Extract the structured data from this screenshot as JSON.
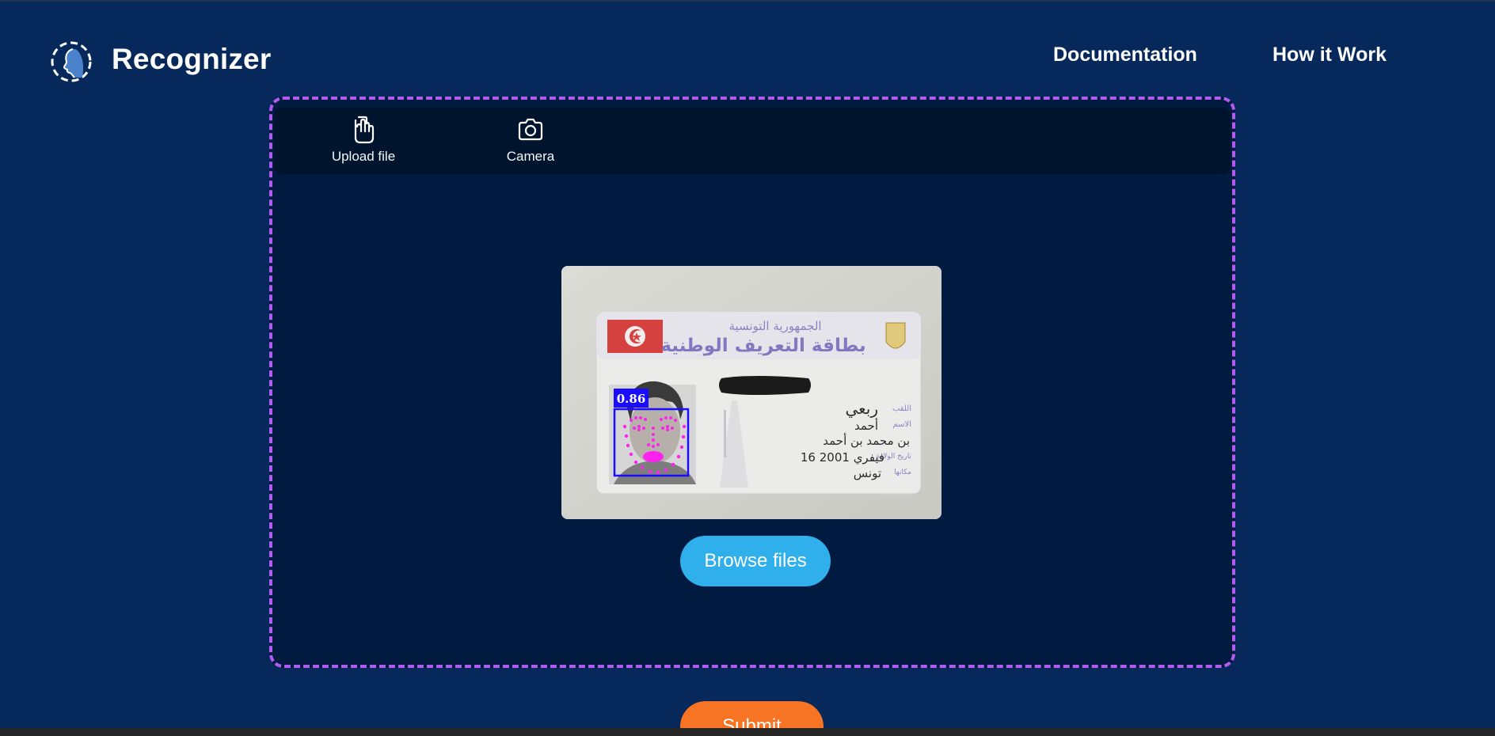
{
  "app": {
    "brand": "Recognizer",
    "logo_icon": "face-profile-logo-icon"
  },
  "nav": {
    "items": [
      {
        "label": "Documentation"
      },
      {
        "label": "How it Work"
      }
    ]
  },
  "upload": {
    "modes": [
      {
        "label": "Upload file",
        "icon": "touch-upload-icon"
      },
      {
        "label": "Camera",
        "icon": "camera-icon"
      }
    ],
    "preview": {
      "detection_score": "0.86",
      "card_text": {
        "header_line1": "الجمهورية التونسية",
        "header_line2": "بطاقة التعريف الوطنية",
        "field_labels": [
          "اللقب",
          "الاسم",
          "تاريخ الولادة",
          "مكانها"
        ],
        "surname": "ربعي",
        "name": "أحمد",
        "lineage": "بن محمد بن أحمد",
        "birth_date": "16 فيفري 2001",
        "birth_place": "تونس"
      }
    },
    "browse_label": "Browse files"
  },
  "submit": {
    "label": "Submit"
  },
  "colors": {
    "background": "#06285a",
    "dropzone_border": "#b15cf0",
    "browse_button": "#2fb0ec",
    "submit_button": "#f67424"
  }
}
